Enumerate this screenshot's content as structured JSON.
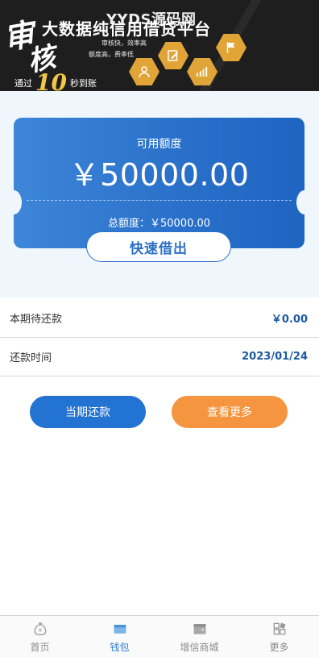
{
  "banner": {
    "headline": "大数据纯信用借贷平台",
    "watermark": "YYDS源码网",
    "calligraphy_1": "审",
    "calligraphy_2": "核",
    "tag_1": "审核快，效率高",
    "tag_2": "额度高，费率低",
    "promo_prefix": "通过",
    "promo_number": "10",
    "promo_suffix": "秒到账"
  },
  "card": {
    "available_label": "可用额度",
    "available_amount": "￥50000.00",
    "total_label": "总额度：￥50000.00",
    "quick_borrow_label": "快速借出"
  },
  "details": {
    "due_label": "本期待还款",
    "due_value": "￥0.00",
    "date_label": "还款时间",
    "date_value": "2023/01/24"
  },
  "actions": {
    "repay_label": "当期还款",
    "more_label": "查看更多"
  },
  "tabs": [
    {
      "label": "首页",
      "icon": "money-bag-icon"
    },
    {
      "label": "钱包",
      "icon": "wallet-icon"
    },
    {
      "label": "增信商城",
      "icon": "store-icon"
    },
    {
      "label": "更多",
      "icon": "grid-icon"
    }
  ],
  "colors": {
    "primary": "#2a71cb",
    "orange": "#f5953f",
    "active_tab": "#2a7fd4",
    "gold": "#e0a437"
  }
}
